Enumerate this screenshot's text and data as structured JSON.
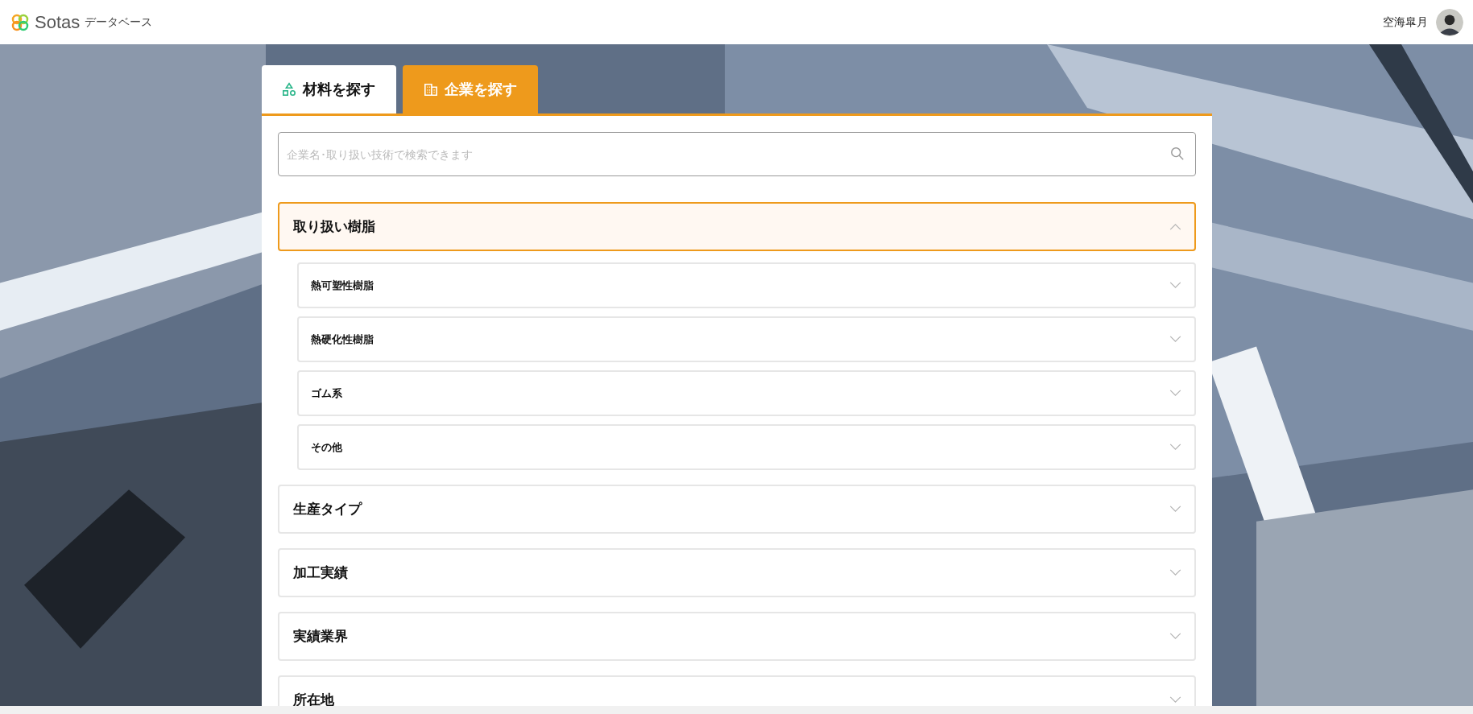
{
  "header": {
    "logo_text": "Sotas",
    "logo_subtitle": "データベース",
    "user_name": "空海皐月"
  },
  "tabs": [
    {
      "label": "材料を探す",
      "kind": "material",
      "selected": false
    },
    {
      "label": "企業を探す",
      "kind": "company",
      "selected": true
    }
  ],
  "search": {
    "placeholder": "企業名･取り扱い技術で検索できます"
  },
  "filters": [
    {
      "label": "取り扱い樹脂",
      "expanded": true,
      "children": [
        {
          "label": "熱可塑性樹脂",
          "expanded": false
        },
        {
          "label": "熱硬化性樹脂",
          "expanded": false
        },
        {
          "label": "ゴム系",
          "expanded": false
        },
        {
          "label": "その他",
          "expanded": false
        }
      ]
    },
    {
      "label": "生産タイプ",
      "expanded": false
    },
    {
      "label": "加工実績",
      "expanded": false
    },
    {
      "label": "実績業界",
      "expanded": false
    },
    {
      "label": "所在地",
      "expanded": false
    }
  ]
}
